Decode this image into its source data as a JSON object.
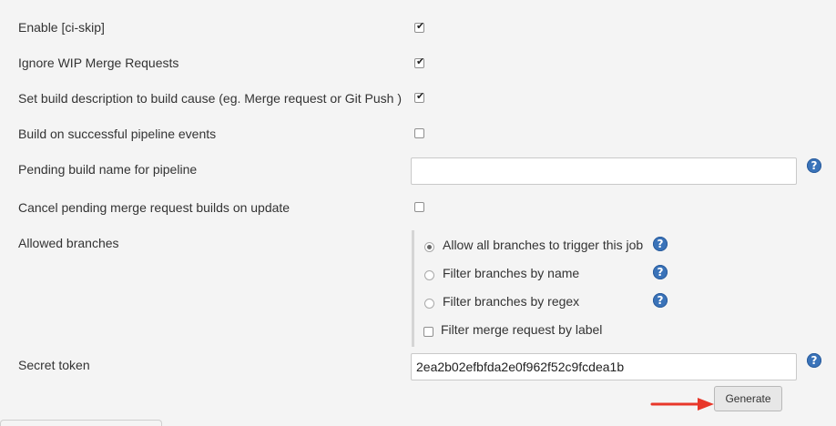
{
  "rows": {
    "ci_skip": {
      "label": "Enable [ci-skip]",
      "checked": true
    },
    "ignore_wip": {
      "label": "Ignore WIP Merge Requests",
      "checked": true
    },
    "build_desc": {
      "label": "Set build description to build cause (eg. Merge request or Git Push )",
      "checked": true
    },
    "pipeline_events": {
      "label": "Build on successful pipeline events",
      "checked": false
    },
    "pending_build_name": {
      "label": "Pending build name for pipeline",
      "value": ""
    },
    "cancel_pending": {
      "label": "Cancel pending merge request builds on update",
      "checked": false
    },
    "allowed_branches": {
      "label": "Allowed branches",
      "options": [
        {
          "label": "Allow all branches to trigger this job",
          "selected": true
        },
        {
          "label": "Filter branches by name",
          "selected": false
        },
        {
          "label": "Filter branches by regex",
          "selected": false
        }
      ],
      "merge_label_filter": {
        "label": "Filter merge request by label",
        "checked": false
      }
    },
    "secret_token": {
      "label": "Secret token",
      "value": "2ea2b02efbfda2e0f962f52c9fcdea1b"
    }
  },
  "generate_button": {
    "label": "Generate"
  },
  "colors": {
    "help": "#3a73b9",
    "arrow": "#e8372a",
    "background": "#f4f4f4"
  },
  "icons": {
    "help": "help-icon",
    "arrow": "red-arrow-annotation"
  }
}
